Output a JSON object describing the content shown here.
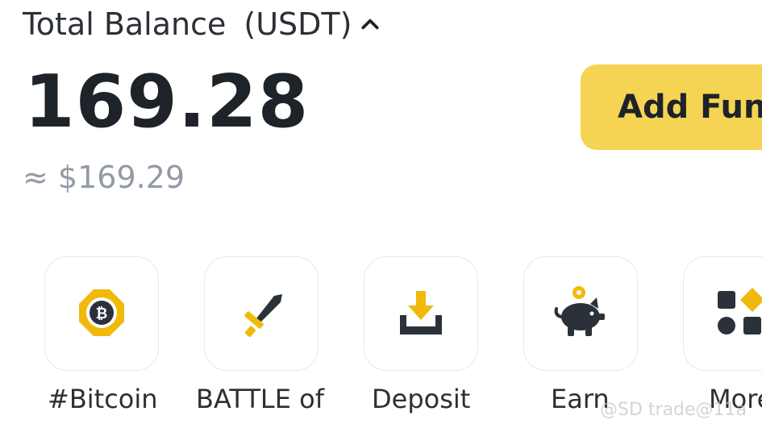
{
  "balance": {
    "title": "Total Balance",
    "currency": "(USDT)",
    "amount": "169.28",
    "fiat_equivalent": "≈ $169.29",
    "add_funds_label": "Add Funds"
  },
  "shortcuts": [
    {
      "label": "#Bitcoin",
      "icon": "bitcoin-badge-icon"
    },
    {
      "label": "BATTLE of",
      "icon": "sword-icon"
    },
    {
      "label": "Deposit",
      "icon": "download-tray-icon"
    },
    {
      "label": "Earn",
      "icon": "piggy-bank-icon"
    },
    {
      "label": "More",
      "icon": "grid-shapes-icon"
    }
  ],
  "watermark": "@SD trade@11a",
  "colors": {
    "accent": "#f0b90b",
    "button_bg": "#f5d453",
    "text_primary": "#1e2329",
    "text_secondary": "#929aa5"
  }
}
